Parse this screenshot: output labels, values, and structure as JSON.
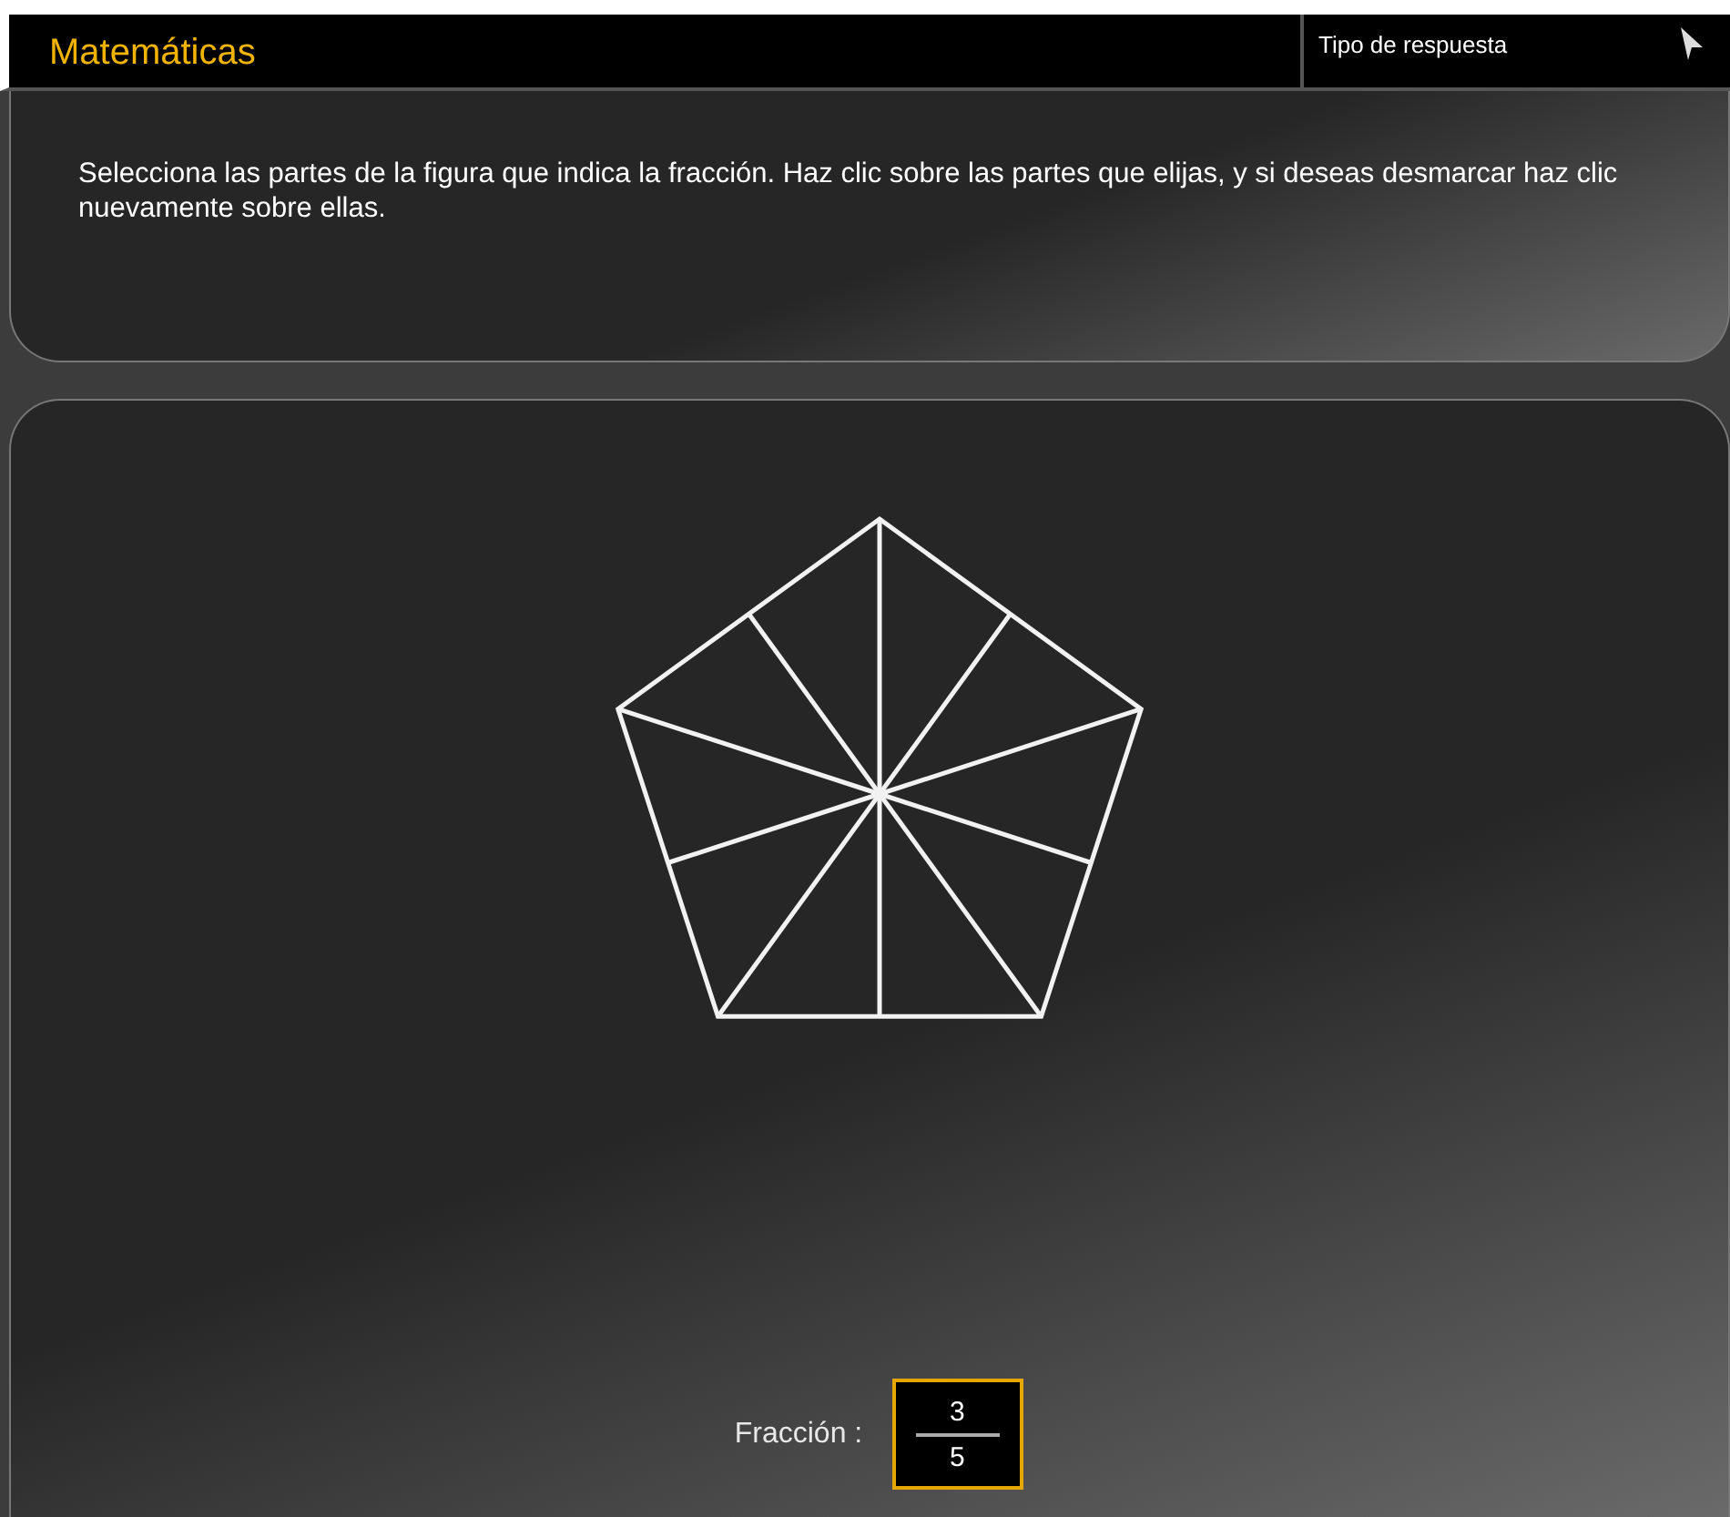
{
  "header": {
    "title": "Matemáticas",
    "answer_type": "Tipo de respuesta"
  },
  "instructions": "Selecciona las partes de la figura que indica la fracción. Haz clic sobre las partes que elijas, y si deseas desmarcar haz clic nuevamente sobre ellas.",
  "fraction": {
    "label": "Fracción :",
    "numerator": "3",
    "denominator": "5"
  }
}
